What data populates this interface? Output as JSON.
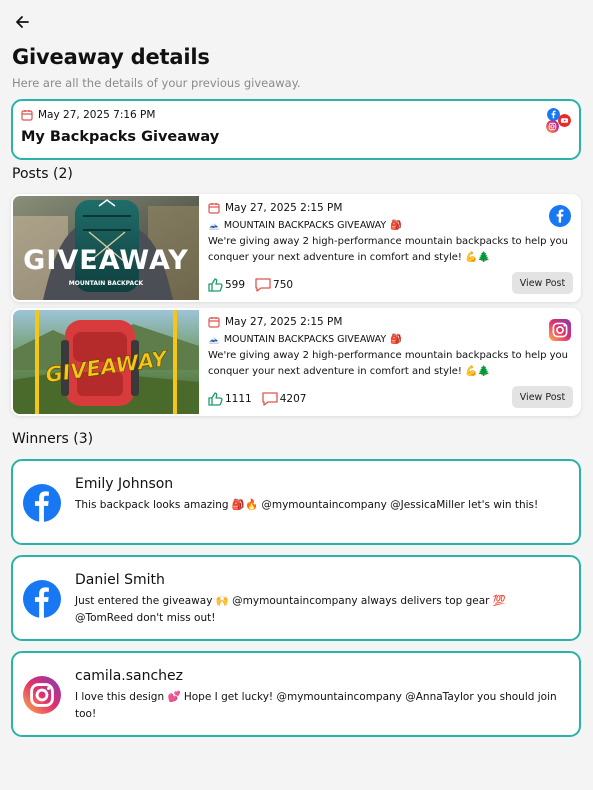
{
  "header": {
    "title": "Giveaway details",
    "subtitle": "Here are all the details of your previous giveaway."
  },
  "summary": {
    "date": "May 27, 2025 7:16 PM",
    "name": "My Backpacks Giveaway",
    "platform_icons": [
      "facebook-icon",
      "instagram-icon",
      "youtube-icon"
    ]
  },
  "posts_section": {
    "label": "Posts (2)"
  },
  "posts": [
    {
      "date": "May 27, 2025 2:15 PM",
      "heading": "MOUNTAIN BACKPACKS GIVEAWAY",
      "description": "We're giving away 2 high-performance mountain backpacks to help you conquer your next adventure in comfort and style!",
      "likes": "599",
      "comments": "750",
      "button": "View Post",
      "platform": "facebook-icon",
      "thumb_text": "GIVEAWAY",
      "thumb_subtext": "MOUNTAIN BACKPACK"
    },
    {
      "date": "May 27, 2025 2:15 PM",
      "heading": "MOUNTAIN BACKPACKS GIVEAWAY",
      "description": "We're giving away 2 high-performance mountain backpacks to help you conquer your next adventure in comfort and style!",
      "likes": "1111",
      "comments": "4207",
      "button": "View Post",
      "platform": "instagram-icon",
      "thumb_text": "GIVEAWAY"
    }
  ],
  "winners_section": {
    "label": "Winners (3)"
  },
  "winners": [
    {
      "name": "Emily Johnson",
      "comment": "This backpack looks amazing 🎒🔥 @mymountaincompany @JessicaMiller let's win this!",
      "platform": "facebook-icon"
    },
    {
      "name": "Daniel Smith",
      "comment": "Just entered the giveaway 🙌 @mymountaincompany always delivers top gear 💯 @TomReed don't miss out!",
      "platform": "facebook-icon"
    },
    {
      "name": "camila.sanchez",
      "comment": "I love this design 💕 Hope I get lucky! @mymountaincompany @AnnaTaylor you should join too!",
      "platform": "instagram-icon"
    }
  ],
  "colors": {
    "accent": "#2bb3aa",
    "calendar": "#e0544f",
    "like": "#1f9a6a",
    "comment": "#e0544f",
    "facebook": "#1877f2"
  }
}
